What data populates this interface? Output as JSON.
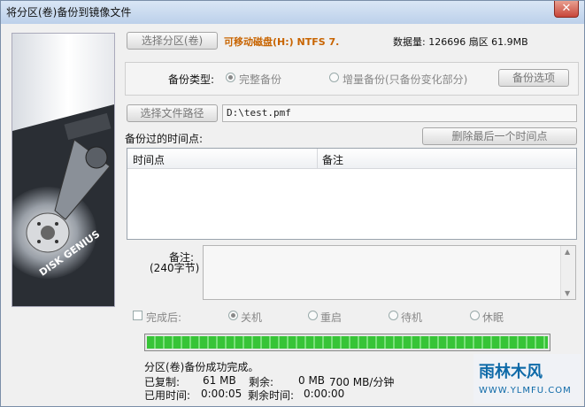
{
  "window": {
    "title": "将分区(卷)备份到镜像文件",
    "close_glyph": "✕"
  },
  "partition": {
    "select_button": "选择分区(卷)",
    "name": "可移动磁盘(H:) NTFS 7.",
    "size_text": "数据量: 126696 扇区  61.9MB"
  },
  "backup_type": {
    "label": "备份类型:",
    "full": "完整备份",
    "incremental": "增量备份(只备份变化部分)",
    "options_button": "备份选项"
  },
  "file": {
    "select_button": "选择文件路径",
    "path": "D:\\test.pmf"
  },
  "history": {
    "label": "备份过的时间点:",
    "delete_button": "删除最后一个时间点",
    "columns": [
      "时间点",
      "备注"
    ]
  },
  "memo": {
    "label": "备注:",
    "sublabel": "(240字节)"
  },
  "after": {
    "checkbox_label": "完成后:",
    "options": [
      "关机",
      "重启",
      "待机",
      "休眠"
    ]
  },
  "progress": {
    "fraction": 1.0
  },
  "status": {
    "message": "分区(卷)备份成功完成。",
    "copied_label": "已复制:",
    "copied_value": "61 MB",
    "remaining_label": "剩余:",
    "remaining_value": "0 MB",
    "speed": "700 MB/分钟",
    "elapsed_label": "已用时间:",
    "elapsed_value": "0:00:05",
    "remaining_time_label": "剩余时间:",
    "remaining_time_value": "0:00:00"
  },
  "watermark": {
    "text": "雨林木风",
    "url": "WWW.YLMFU.COM"
  },
  "disk_brand": "DISK GENIUS"
}
